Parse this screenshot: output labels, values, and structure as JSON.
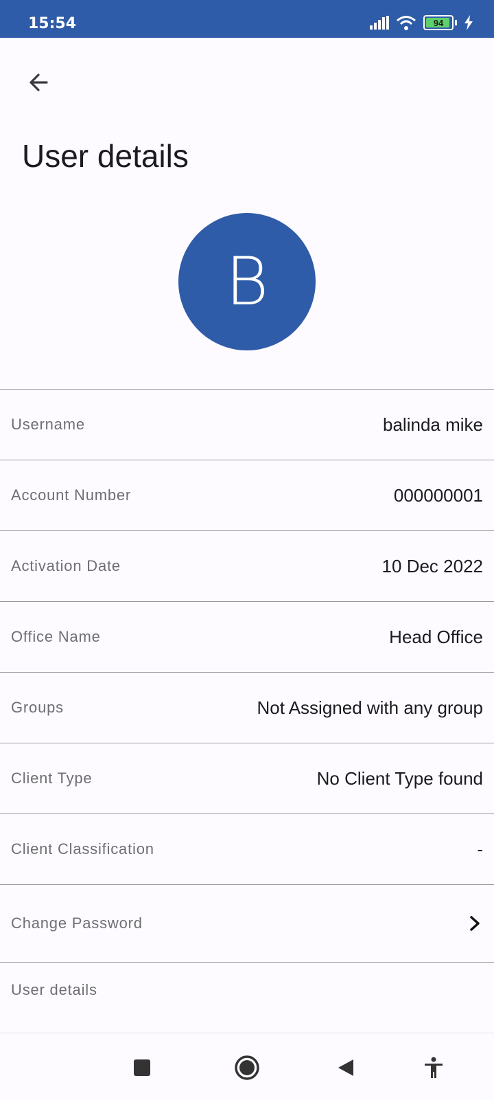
{
  "status_bar": {
    "time": "15:54",
    "battery_level": "94",
    "icons": [
      "signal-icon",
      "wifi-icon",
      "battery-icon",
      "charging-icon"
    ]
  },
  "header": {
    "back_icon": "arrow-left-icon",
    "title": "User details"
  },
  "avatar": {
    "initial": "B",
    "color": "#2f5ca8"
  },
  "details": [
    {
      "label": "Username",
      "value": "balinda mike"
    },
    {
      "label": "Account Number",
      "value": "000000001"
    },
    {
      "label": "Activation Date",
      "value": "10 Dec 2022"
    },
    {
      "label": "Office Name",
      "value": "Head Office"
    },
    {
      "label": "Groups",
      "value": "Not Assigned with any group"
    },
    {
      "label": "Client Type",
      "value": "No Client Type found"
    },
    {
      "label": "Client Classification",
      "value": "-"
    }
  ],
  "change_password": {
    "label": "Change Password",
    "icon": "chevron-right-icon"
  },
  "section": {
    "label": "User details"
  },
  "nav_bar": {
    "icons": [
      "recents-icon",
      "home-icon",
      "back-triangle-icon",
      "accessibility-icon"
    ]
  },
  "colors": {
    "primary": "#2f5ca8",
    "background": "#fdfbff",
    "label": "#6e6e73"
  }
}
